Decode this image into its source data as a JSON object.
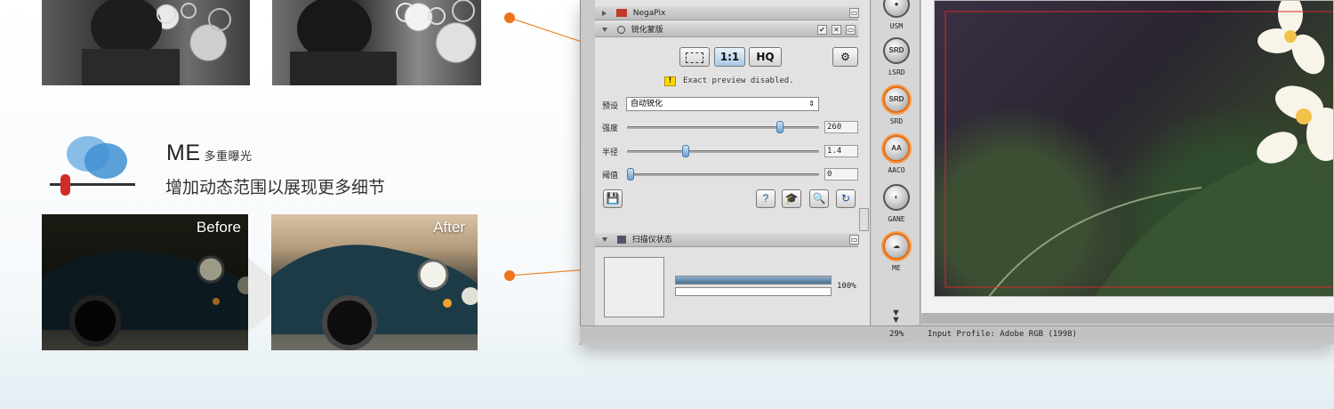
{
  "feature": {
    "title": "ME",
    "subtitle": "多重曝光",
    "description": "增加动态范围以展现更多细节",
    "before_label": "Before",
    "after_label": "After"
  },
  "app": {
    "panels": {
      "negapix": "NegaPix",
      "sharpen": "锐化蒙版",
      "scanner_status": "扫描仪状态"
    },
    "toolbar": {
      "fit_label": "",
      "one_to_one_label": "1:1",
      "hq_label": "HQ"
    },
    "warning": "Exact preview disabled.",
    "preset": {
      "label": "预设",
      "value": "自动锐化"
    },
    "sliders": [
      {
        "label": "强度",
        "value": "260",
        "fraction": 0.81
      },
      {
        "label": "半径",
        "value": "1.4",
        "fraction": 0.3
      },
      {
        "label": "阈值",
        "value": "0",
        "fraction": 0.0
      }
    ],
    "progress": {
      "percent_label": "100%",
      "value": 1.0
    },
    "tools": [
      {
        "name": "USM",
        "active": false
      },
      {
        "name": "iSRD",
        "active": false
      },
      {
        "name": "SRD",
        "active": true
      },
      {
        "name": "AACO",
        "active": true
      },
      {
        "name": "GANE",
        "active": false
      },
      {
        "name": "ME",
        "active": true
      }
    ],
    "status": {
      "zoom": "29%",
      "profile": "Input Profile: Adobe RGB (1998)"
    },
    "colors": {
      "highlight": "#f28a2e",
      "accent": "#e36b12"
    }
  }
}
